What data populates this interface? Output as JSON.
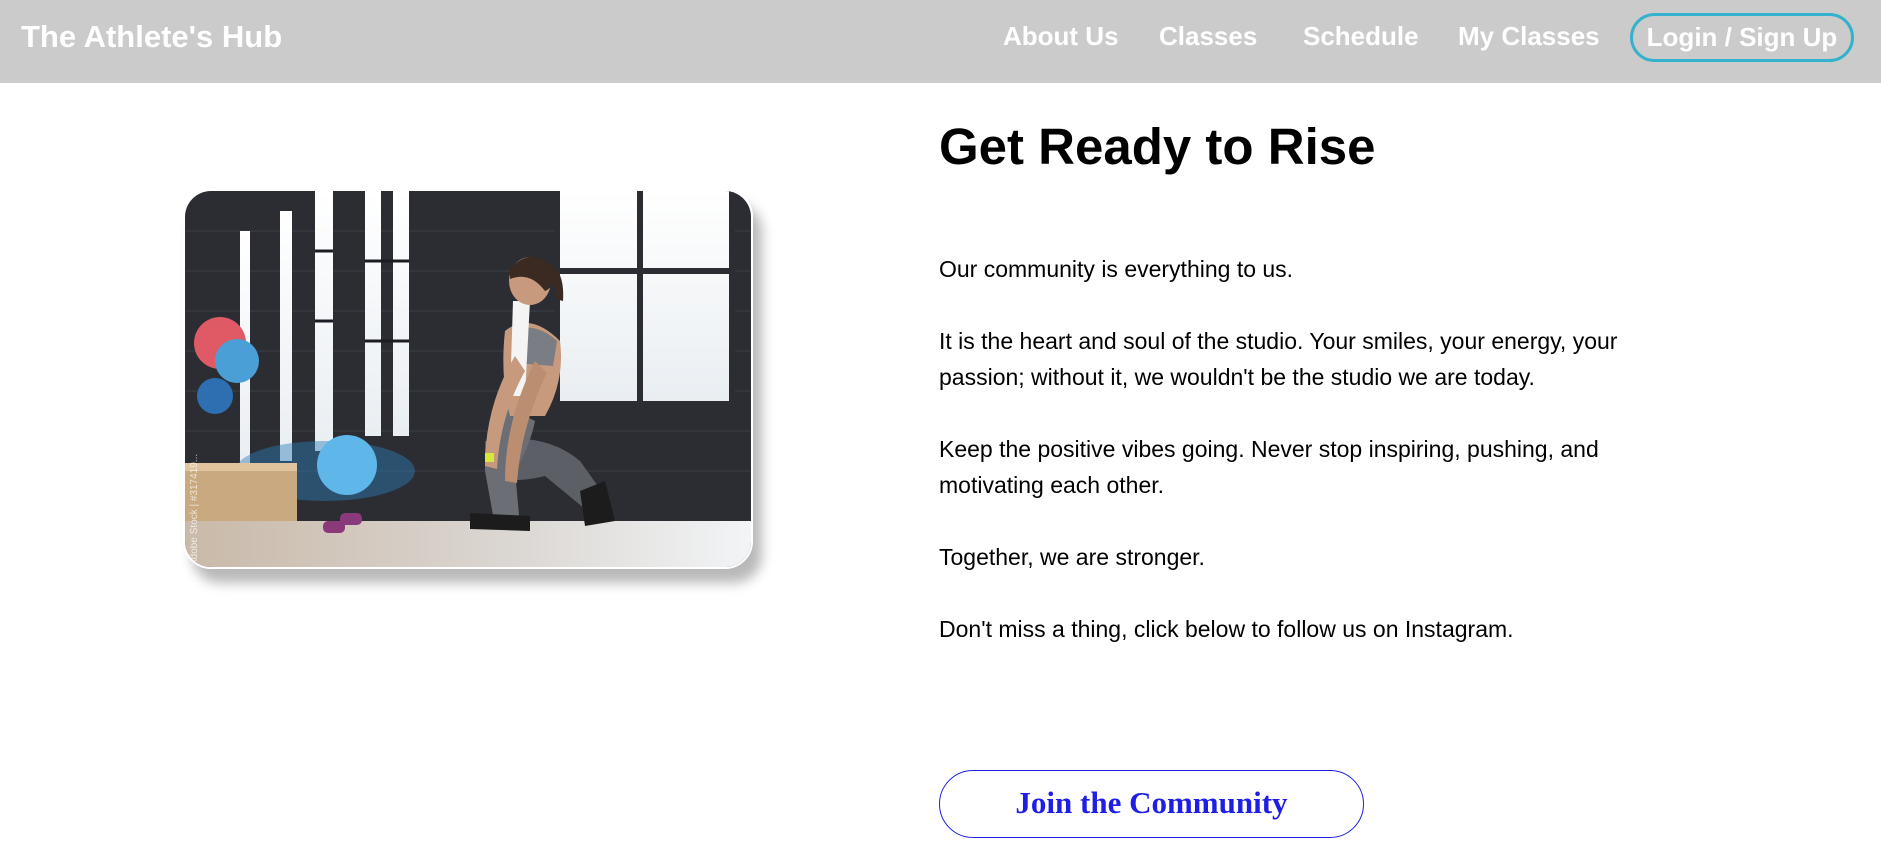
{
  "header": {
    "brand": "The Athlete's Hub",
    "nav": {
      "about": "About Us",
      "classes": "Classes",
      "schedule": "Schedule",
      "my_classes": "My Classes",
      "login": "Login / Sign Up"
    }
  },
  "hero": {
    "image_watermark": "Adobe Stock | #317419..."
  },
  "main": {
    "title": "Get Ready to Rise",
    "paragraphs": [
      "Our community is everything to us.",
      "It is the heart and soul of the studio. Your smiles, your energy, your passion; without it, we wouldn't be the studio we are today.",
      "Keep the positive vibes going. Never stop inspiring, pushing, and motivating each other.",
      "Together, we are stronger.",
      "Don't miss a thing, click below to follow us on Instagram."
    ],
    "cta_label": "Join the Community"
  },
  "colors": {
    "navbar_bg": "#cbcbcb",
    "login_border": "#34b1cc",
    "cta_blue": "#1e1ee6"
  }
}
